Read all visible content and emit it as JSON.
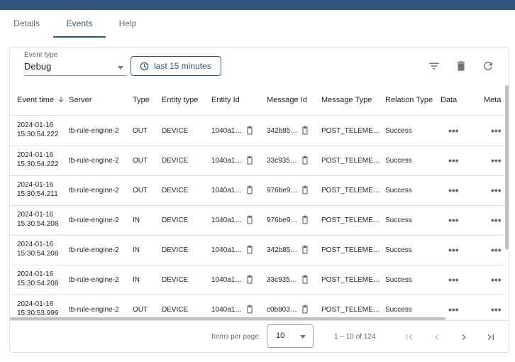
{
  "colors": {
    "topbar": "#305680",
    "accent": "#305680",
    "tab_ink": "#305680"
  },
  "tabs": [
    {
      "label": "Details",
      "active": false
    },
    {
      "label": "Events",
      "active": true
    },
    {
      "label": "Help",
      "active": false
    }
  ],
  "filters": {
    "event_type_label": "Event type",
    "event_type_value": "Debug",
    "time_button_label": "last 15 minutes"
  },
  "toolbar_icons": [
    "filter-icon",
    "delete-icon",
    "refresh-icon"
  ],
  "table": {
    "columns": [
      "Event time",
      "Server",
      "Type",
      "Entity type",
      "Entity Id",
      "Message Id",
      "Message Type",
      "Relation Type",
      "Data",
      "Meta"
    ],
    "rows": [
      {
        "date": "2024-01-16",
        "time": "15:30:54.222",
        "server": "tb-rule-engine-2",
        "type": "OUT",
        "entity_type": "DEVICE",
        "entity_id": "1040a1…",
        "message_id": "342b85…",
        "message_type": "POST_TELEME…",
        "relation_type": "Success"
      },
      {
        "date": "2024-01-16",
        "time": "15:30:54.222",
        "server": "tb-rule-engine-2",
        "type": "OUT",
        "entity_type": "DEVICE",
        "entity_id": "1040a1…",
        "message_id": "33c935…",
        "message_type": "POST_TELEME…",
        "relation_type": "Success"
      },
      {
        "date": "2024-01-16",
        "time": "15:30:54.211",
        "server": "tb-rule-engine-2",
        "type": "OUT",
        "entity_type": "DEVICE",
        "entity_id": "1040a1…",
        "message_id": "976be9…",
        "message_type": "POST_TELEME…",
        "relation_type": "Success"
      },
      {
        "date": "2024-01-16",
        "time": "15:30:54.208",
        "server": "tb-rule-engine-2",
        "type": "IN",
        "entity_type": "DEVICE",
        "entity_id": "1040a1…",
        "message_id": "976be9…",
        "message_type": "POST_TELEME…",
        "relation_type": "Success"
      },
      {
        "date": "2024-01-16",
        "time": "15:30:54.208",
        "server": "tb-rule-engine-2",
        "type": "IN",
        "entity_type": "DEVICE",
        "entity_id": "1040a1…",
        "message_id": "342b85…",
        "message_type": "POST_TELEME…",
        "relation_type": "Success"
      },
      {
        "date": "2024-01-16",
        "time": "15:30:54.208",
        "server": "tb-rule-engine-2",
        "type": "IN",
        "entity_type": "DEVICE",
        "entity_id": "1040a1…",
        "message_id": "33c935…",
        "message_type": "POST_TELEME…",
        "relation_type": "Success"
      },
      {
        "date": "2024-01-16",
        "time": "15:30:53.999",
        "server": "tb-rule-engine-2",
        "type": "OUT",
        "entity_type": "DEVICE",
        "entity_id": "1040a1…",
        "message_id": "c0b803…",
        "message_type": "POST_TELEME…",
        "relation_type": "Success"
      }
    ]
  },
  "pager": {
    "items_per_page_label": "Items per page:",
    "items_per_page_value": "10",
    "range_label": "1 – 10 of 124"
  }
}
